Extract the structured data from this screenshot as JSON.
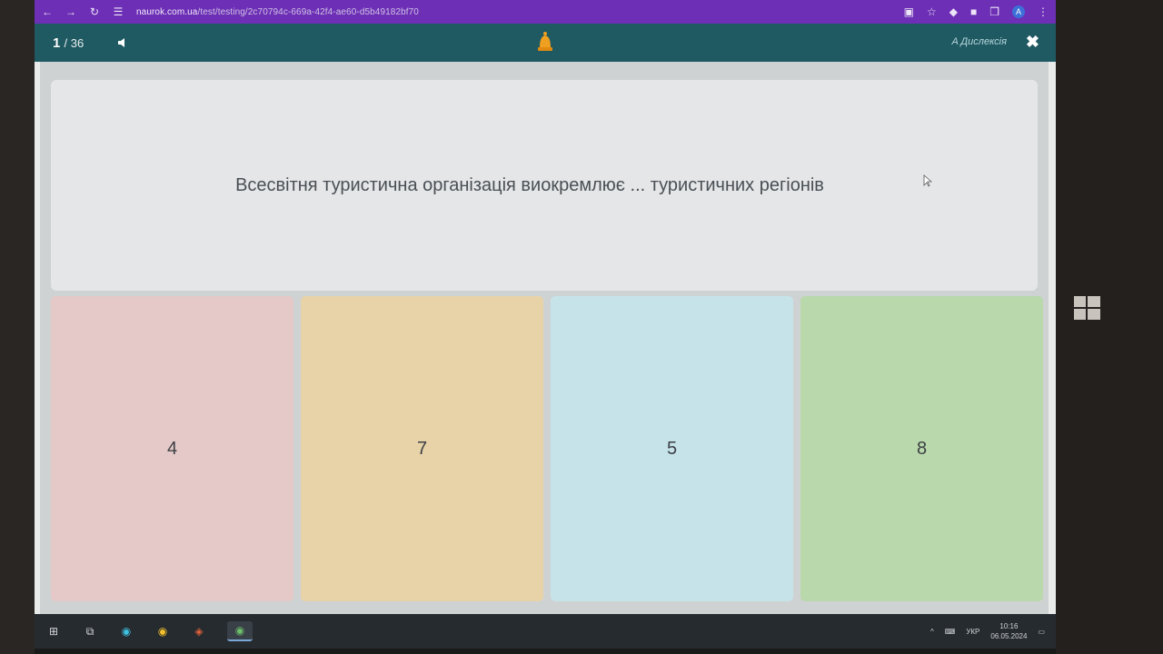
{
  "browser": {
    "url_host": "naurok.com.ua",
    "url_path": "/test/testing/2c70794c-669a-42f4-ae60-d5b49182bf70",
    "avatar_letter": "A"
  },
  "header": {
    "current": "1",
    "total": "/ 36",
    "dyslexia_label": "A Дислексія",
    "close_glyph": "✖"
  },
  "question": {
    "text": "Всесвітня туристична організація виокремлює ... туристичних регіонів"
  },
  "answers": [
    {
      "label": "4",
      "color": "#e4c9c8"
    },
    {
      "label": "7",
      "color": "#e8d3a9"
    },
    {
      "label": "5",
      "color": "#c6e3ea"
    },
    {
      "label": "8",
      "color": "#b9d9ac"
    }
  ],
  "taskbar": {
    "language": "УКР",
    "time": "10:16",
    "date": "06.05.2024"
  },
  "colors": {
    "browser_chrome": "#6d2fb5",
    "header": "#1f5962",
    "bell": "#f0a020"
  }
}
